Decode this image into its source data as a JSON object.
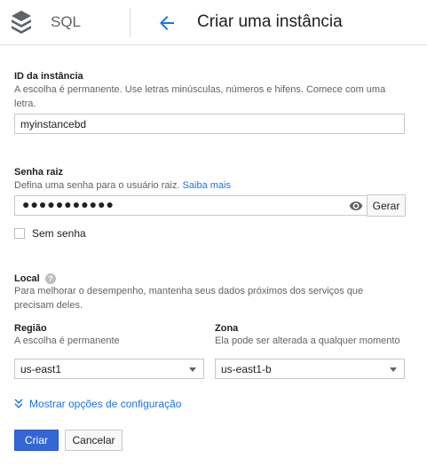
{
  "header": {
    "product": "SQL",
    "title": "Criar uma instância"
  },
  "instance_id": {
    "label": "ID da instância",
    "hint": "A escolha é permanente. Use letras minúsculas, números e hifens. Comece com uma letra.",
    "value": "myinstancebd"
  },
  "root_password": {
    "label": "Senha raiz",
    "hint": "Defina uma senha para o usuário raiz.",
    "learn_more": "Saiba mais",
    "masked_value": "●●●●●●●●●●●",
    "generate_label": "Gerar",
    "no_password_label": "Sem senha",
    "no_password_checked": false
  },
  "location": {
    "label": "Local",
    "hint": "Para melhorar o desempenho, mantenha seus dados próximos dos serviços que precisam deles.",
    "region": {
      "label": "Região",
      "hint": "A escolha é permanente",
      "value": "us-east1"
    },
    "zone": {
      "label": "Zona",
      "hint": "Ela pode ser alterada a qualquer momento",
      "value": "us-east1-b"
    }
  },
  "config_toggle_label": "Mostrar opções de configuração",
  "actions": {
    "create_label": "Criar",
    "cancel_label": "Cancelar"
  },
  "colors": {
    "accent": "#1a73e8",
    "primary_button": "#3367d6"
  },
  "icons": [
    "sql-logo-icon",
    "back-arrow-icon",
    "eye-icon",
    "help-icon",
    "chevron-down-icon",
    "double-chevron-down-icon"
  ]
}
